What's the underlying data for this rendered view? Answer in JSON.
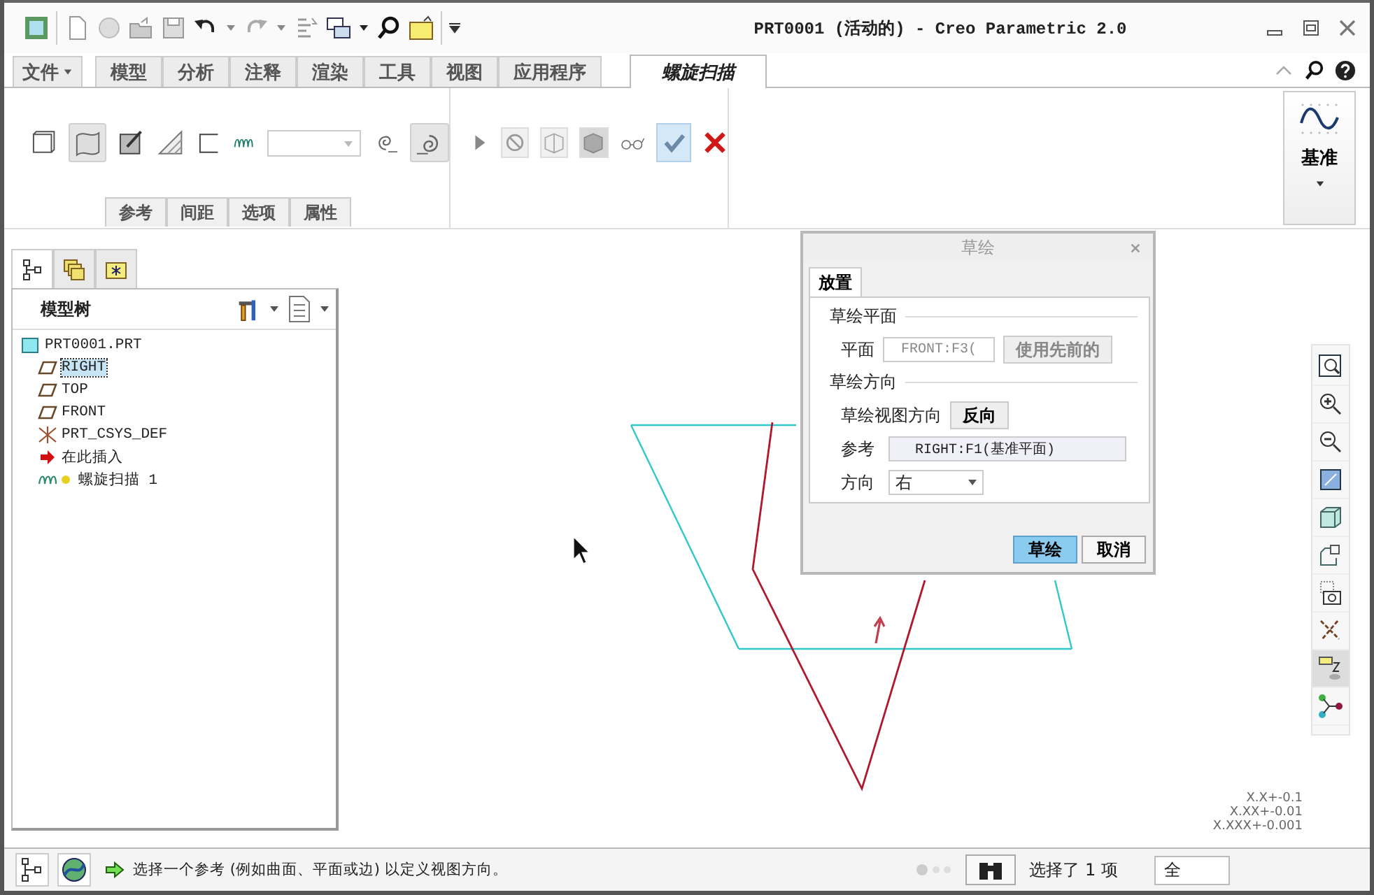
{
  "window": {
    "title": "PRT0001 (活动的) - Creo Parametric 2.0"
  },
  "ribbon": {
    "tabs": [
      {
        "label": "文件",
        "kind": "menu",
        "selected": false
      },
      {
        "label": "模型",
        "kind": "tab",
        "selected": false
      },
      {
        "label": "分析",
        "kind": "tab",
        "selected": false
      },
      {
        "label": "注释",
        "kind": "tab",
        "selected": false
      },
      {
        "label": "渲染",
        "kind": "tab",
        "selected": false
      },
      {
        "label": "工具",
        "kind": "tab",
        "selected": false
      },
      {
        "label": "视图",
        "kind": "tab",
        "selected": false
      },
      {
        "label": "应用程序",
        "kind": "tab",
        "selected": false
      },
      {
        "label": "螺旋扫描",
        "kind": "tab",
        "selected": true
      }
    ],
    "subtabs": [
      "参考",
      "间距",
      "选项",
      "属性"
    ],
    "datum_button": "基准"
  },
  "model_tree": {
    "tabs": [
      {
        "kind": "tree",
        "selected": true
      },
      {
        "kind": "layers",
        "selected": false
      },
      {
        "kind": "favorites",
        "selected": false
      }
    ],
    "title": "模型树",
    "root": {
      "label": "PRT0001.PRT",
      "kind": "part",
      "children": [
        {
          "label": "RIGHT",
          "kind": "plane",
          "selected": true
        },
        {
          "label": "TOP",
          "kind": "plane",
          "selected": false
        },
        {
          "label": "FRONT",
          "kind": "plane",
          "selected": false
        },
        {
          "label": "PRT_CSYS_DEF",
          "kind": "csys",
          "selected": false
        },
        {
          "label": "在此插入",
          "kind": "insert",
          "selected": false
        },
        {
          "label": "螺旋扫描 1",
          "kind": "helix",
          "selected": false
        }
      ]
    }
  },
  "dialog": {
    "title": "草绘",
    "tabs": [
      {
        "label": "放置",
        "selected": true
      }
    ],
    "plane_heading": "草绘平面",
    "plane_label": "平面",
    "plane_value": "FRONT:F3(",
    "use_previous_button": "使用先前的",
    "orientation_heading": "草绘方向",
    "view_direction_label": "草绘视图方向",
    "flip_button": "反向",
    "reference_label": "参考",
    "reference_value": "RIGHT:F1(基准平面)",
    "direction_label": "方向",
    "direction_value": "右",
    "buttons": [
      {
        "label": "草绘",
        "primary": true
      },
      {
        "label": "取消",
        "primary": false
      }
    ]
  },
  "tolerances": [
    "X.X+-0.1",
    "X.XX+-0.01",
    "X.XXX+-0.001"
  ],
  "status_bar": {
    "message": "选择一个参考 (例如曲面、平面或边) 以定义视图方向。",
    "selection": "选择了 1 项",
    "filter": "全"
  }
}
